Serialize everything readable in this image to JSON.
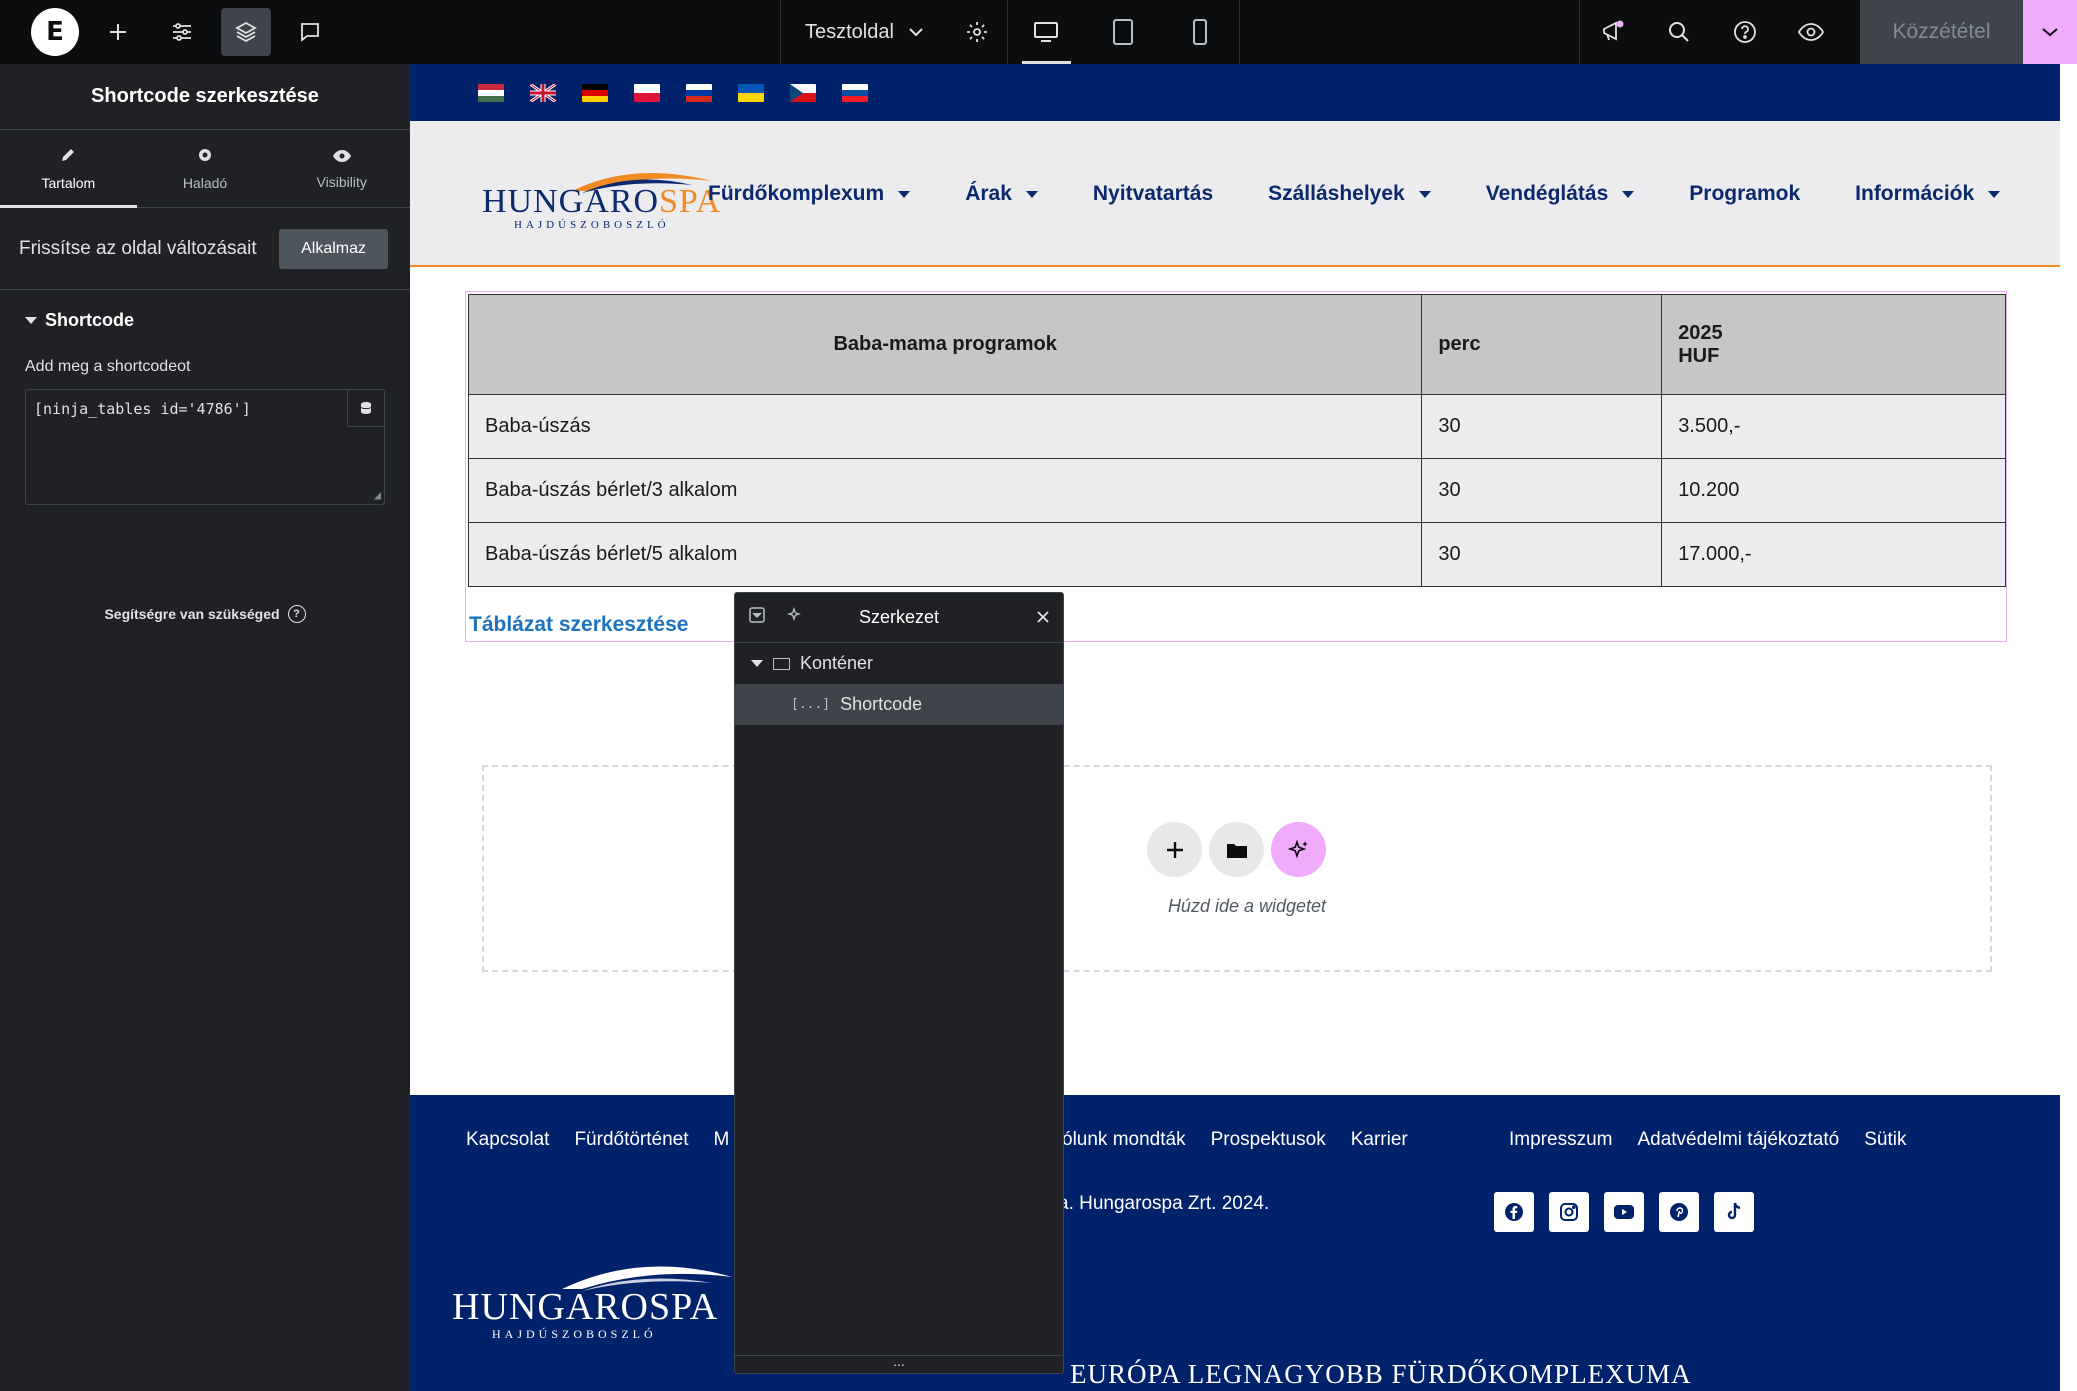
{
  "topbar": {
    "page_name": "Tesztoldal",
    "publish_label": "Közzététel",
    "icons": [
      "elementor-logo-icon",
      "add-icon",
      "sliders-icon",
      "layers-icon",
      "comment-icon",
      "chevron-down-icon",
      "gear-icon",
      "desktop-icon",
      "tablet-icon",
      "mobile-icon",
      "megaphone-icon",
      "search-icon",
      "help-icon",
      "eye-icon"
    ]
  },
  "panel": {
    "title": "Shortcode szerkesztése",
    "tabs": [
      {
        "label": "Tartalom",
        "icon": "pencil-icon"
      },
      {
        "label": "Haladó",
        "icon": "gear-icon"
      },
      {
        "label": "Visibility",
        "icon": "eye-icon"
      }
    ],
    "refresh_text": "Frissítse az oldal változásait",
    "apply_label": "Alkalmaz",
    "section_title": "Shortcode",
    "field_label": "Add meg a shortcodeot",
    "shortcode_value": "[ninja_tables id='4786']",
    "help_text": "Segítségre van szükséged"
  },
  "site": {
    "logo_word_a": "HUNGARO",
    "logo_word_b": "SPA",
    "logo_sub": "HAJDÚSZOBOSZLÓ",
    "nav": [
      "Fürdőkomplexum",
      "Árak",
      "Nyitvatartás",
      "Szálláshelyek",
      "Vendéglátás",
      "Programok",
      "Információk"
    ],
    "table": {
      "headers": [
        "Baba-mama programok",
        "perc",
        "2025",
        "HUF"
      ],
      "rows": [
        [
          "Baba-úszás",
          "30",
          "3.500,-"
        ],
        [
          "Baba-úszás bérlet/3 alkalom",
          "30",
          "10.200"
        ],
        [
          "Baba-úszás bérlet/5 alkalom",
          "30",
          "17.000,-"
        ]
      ]
    },
    "edit_link": "Táblázat szerkesztése",
    "dropzone_text": "Húzd ide a widgetet",
    "footer": {
      "links_left": [
        "Kapcsolat",
        "Fürdőtörténet",
        "M"
      ],
      "links_mid": [
        "ólunk mondták",
        "Prospektusok",
        "Karrier"
      ],
      "links_right": [
        "Impresszum",
        "Adatvédelmi tájékoztató",
        "Sütik"
      ],
      "copyright": "a. Hungarospa Zrt. 2024.",
      "logo_word": "HUNGAROSPA",
      "logo_sub": "HAJDÚSZOBOSZLÓ",
      "slogan": "EURÓPA LEGNAGYOBB FÜRDŐKOMPLEXUMA",
      "socials": [
        "facebook-icon",
        "instagram-icon",
        "youtube-icon",
        "pinterest-icon",
        "tiktok-icon"
      ]
    }
  },
  "navigator": {
    "title": "Szerkezet",
    "items": [
      {
        "label": "Konténer"
      },
      {
        "label": "Shortcode"
      }
    ]
  },
  "colors": {
    "accent_pink": "#f0abfc",
    "site_navy": "#00226a",
    "site_orange": "#f08a24",
    "link_blue": "#1e73be"
  }
}
